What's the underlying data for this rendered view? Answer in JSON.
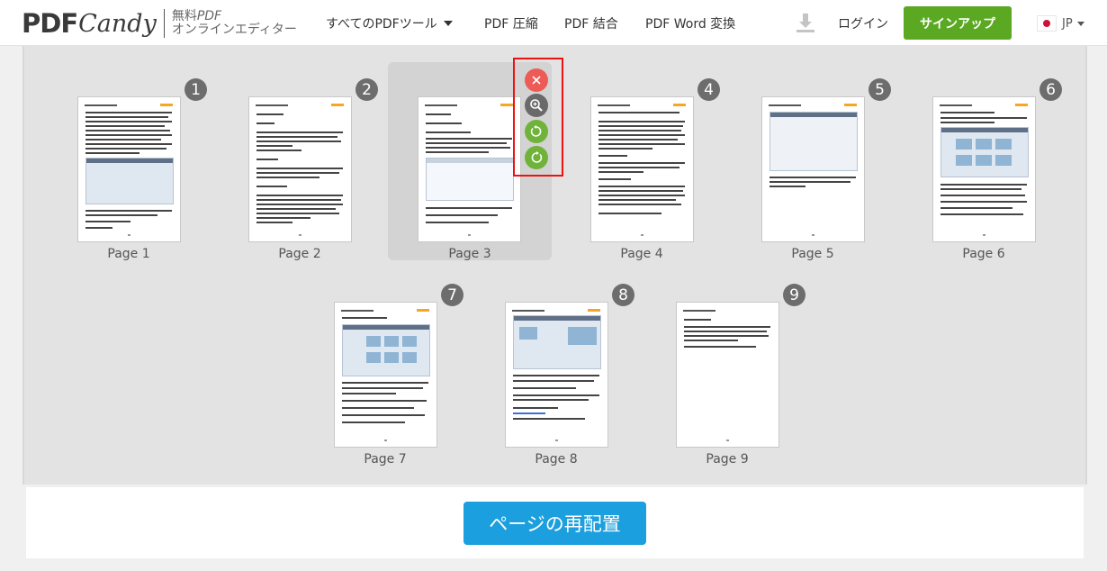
{
  "header": {
    "logo_pdf": "PDF",
    "logo_candy": "Candy",
    "tagline_line1_prefix": "無料",
    "tagline_line1_suffix": "PDF",
    "tagline_line2": "オンラインエディター",
    "nav_all_tools": "すべてのPDFツール",
    "nav_compress": "PDF 圧縮",
    "nav_merge": "PDF 結合",
    "nav_word": "PDF Word 変換",
    "login": "ログイン",
    "signup": "サインアップ",
    "language": "JP"
  },
  "pages": [
    {
      "number": "1",
      "label": "Page 1",
      "selected": false
    },
    {
      "number": "2",
      "label": "Page 2",
      "selected": false
    },
    {
      "number": "3",
      "label": "Page 3",
      "selected": true
    },
    {
      "number": "4",
      "label": "Page 4",
      "selected": false
    },
    {
      "number": "5",
      "label": "Page 5",
      "selected": false
    },
    {
      "number": "6",
      "label": "Page 6",
      "selected": false
    },
    {
      "number": "7",
      "label": "Page 7",
      "selected": false
    },
    {
      "number": "8",
      "label": "Page 8",
      "selected": false
    },
    {
      "number": "9",
      "label": "Page 9",
      "selected": false
    }
  ],
  "page_tools": {
    "icons": [
      "close-icon",
      "zoom-in-icon",
      "rotate-left-icon",
      "rotate-right-icon"
    ]
  },
  "action": {
    "rearrange_button": "ページの再配置"
  },
  "colors": {
    "signup": "#5ba823",
    "primary_button": "#1b9fde",
    "delete": "#ec5b56",
    "rotate": "#6fb33a",
    "highlight_border": "#e11111"
  }
}
